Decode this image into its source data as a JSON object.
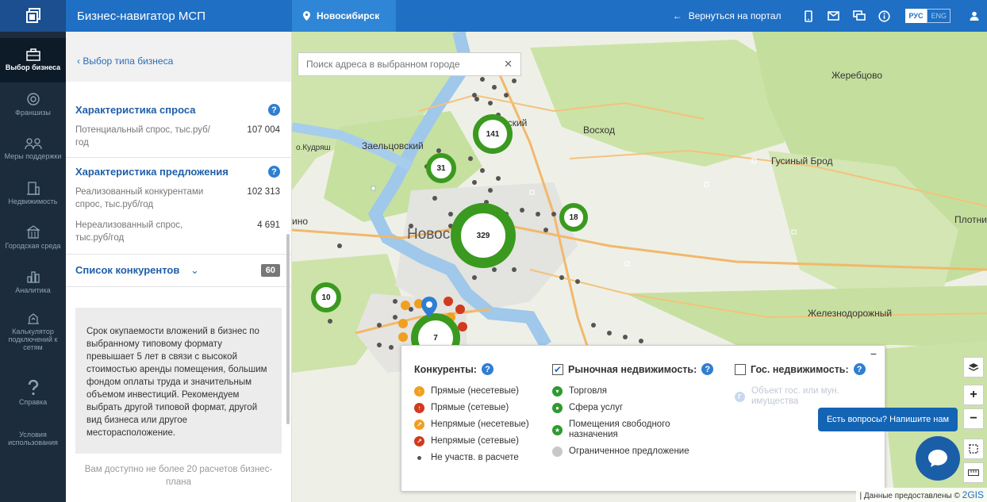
{
  "topbar": {
    "app_title": "Бизнес-навигатор МСП",
    "city": "Новосибирск",
    "back_label": "Вернуться на портал",
    "lang_active": "РУС",
    "lang_inactive": "ENG"
  },
  "nav": [
    {
      "label": "Выбор бизнеса",
      "icon": "briefcase-icon"
    },
    {
      "label": "Франшизы",
      "icon": "franchise-icon"
    },
    {
      "label": "Меры поддержки",
      "icon": "support-icon"
    },
    {
      "label": "Недвижимость",
      "icon": "building-icon"
    },
    {
      "label": "Городская среда",
      "icon": "city-icon"
    },
    {
      "label": "Аналитика",
      "icon": "chart-icon"
    },
    {
      "label": "Калькулятор подключений к сетям",
      "icon": "calculator-icon"
    },
    {
      "label": "Справка",
      "icon": "question-icon"
    },
    {
      "label": "Условия использования",
      "icon": "terms-icon"
    }
  ],
  "panel": {
    "back_link": "‹ Выбор типа бизнеса",
    "demand": {
      "title": "Характеристика спроса",
      "rows": [
        {
          "label": "Потенциальный спрос, тыс.руб/год",
          "value": "107 004"
        }
      ]
    },
    "supply": {
      "title": "Характеристика предложения",
      "rows": [
        {
          "label": "Реализованный конкурентами спрос, тыс.руб/год",
          "value": "102 313"
        },
        {
          "label": "Нереализованный спрос, тыс.руб/год",
          "value": "4 691"
        }
      ]
    },
    "competitors": {
      "title": "Список конкурентов",
      "count": "60"
    },
    "warning": "Срок окупаемости вложений в бизнес по выбранному типовому формату превышает 5 лет в связи с высокой стоимостью аренды помещения, большим фондом оплаты труда и значительным объемом инвестиций. Рекомендуем выбрать другой типовой формат, другой вид бизнеса или другое месторасположение.",
    "limit": "Вам доступно не более 20 расчетов бизнес-плана"
  },
  "map": {
    "search_placeholder": "Поиск адреса в выбранном городе",
    "places": {
      "kudryash": "о.Кудряш",
      "zaeltsovsky": "Заельцовский",
      "voshod": "Восход",
      "zherebtsovo": "Жеребцово",
      "gusiny_brod": "Гусиный Брод",
      "plotni": "Плотни",
      "novosibirsk": "Новосибирск",
      "zheleznodorozhny": "Железнодорожный",
      "no": "ино",
      "nsky": "нский"
    },
    "clusters": [
      "141",
      "31",
      "329",
      "18",
      "10",
      "7"
    ],
    "credits": "| Данные предоставлены ©",
    "credits_brand": "2GIS",
    "chat_prompt": "Есть вопросы? Напишите нам"
  },
  "legend": {
    "competitors_title": "Конкуренты:",
    "competitors": [
      {
        "label": "Прямые (несетевые)",
        "color": "#f0a020"
      },
      {
        "label": "Прямые (сетевые)",
        "color": "#d23a1e"
      },
      {
        "label": "Непрямые (несетевые)",
        "color": "#f0a020"
      },
      {
        "label": "Непрямые (сетевые)",
        "color": "#d23a1e"
      },
      {
        "label": "Не участв. в расчете",
        "color": "#555555"
      }
    ],
    "market_title": "Рыночная недвижимость:",
    "market": [
      {
        "label": "Торговля",
        "color": "#2e9a2e"
      },
      {
        "label": "Сфера услуг",
        "color": "#2e9a2e"
      },
      {
        "label": "Помещения свободного назначения",
        "color": "#2e9a2e"
      },
      {
        "label": "Ограниченное предложение",
        "color": "#bbbbbb"
      }
    ],
    "gov_title": "Гос. недвижимость:",
    "gov": [
      {
        "label": "Объект гос. или мун. имущества",
        "color": "#c8d8f0"
      }
    ]
  }
}
